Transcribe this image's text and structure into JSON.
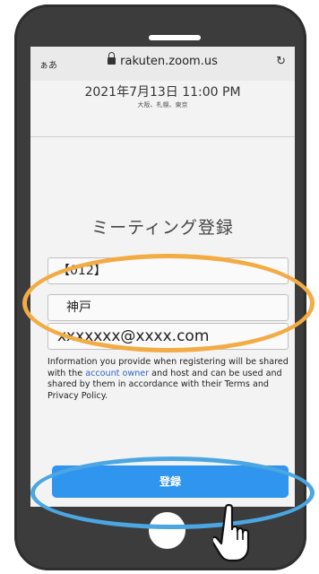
{
  "browser": {
    "text_size_label": "ぁあ",
    "url": "rakuten.zoom.us",
    "reload_icon": "reload-icon"
  },
  "meeting": {
    "datetime": "2021年7月13日 11:00 PM",
    "location": "大阪、札幌、東京"
  },
  "form": {
    "title": "ミーティング登録",
    "field1_value": "【012】",
    "field2_value": "神戸",
    "field3_value": "xxxxxxx@xxxx.com",
    "disclaimer_start": "Information you provide when registering will be shared with the ",
    "disclaimer_link": "account owner",
    "disclaimer_end": " and host and can be used and shared by them in accordance with their Terms and Privacy Policy.",
    "submit_label": "登録"
  },
  "colors": {
    "highlight_orange": "#f3ab44",
    "highlight_blue": "#4ba6e2",
    "button_blue": "#2f95ee"
  }
}
